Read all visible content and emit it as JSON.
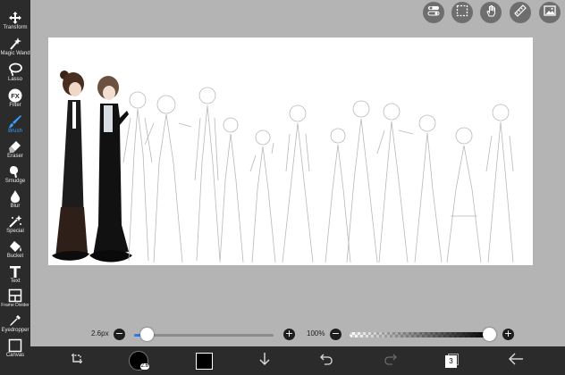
{
  "toolbar": {
    "items": [
      {
        "label": "Transform",
        "icon": "move-arrows-icon"
      },
      {
        "label": "Magic Wand",
        "icon": "magic-wand-icon"
      },
      {
        "label": "Lasso",
        "icon": "lasso-icon"
      },
      {
        "label": "Filter",
        "icon": "fx-icon"
      },
      {
        "label": "Brush",
        "icon": "brush-icon"
      },
      {
        "label": "Eraser",
        "icon": "eraser-icon"
      },
      {
        "label": "Smudge",
        "icon": "smudge-icon"
      },
      {
        "label": "Blur",
        "icon": "drop-icon"
      },
      {
        "label": "Special",
        "icon": "sparkle-icon"
      },
      {
        "label": "Bucket",
        "icon": "bucket-icon"
      },
      {
        "label": "Text",
        "icon": "text-icon"
      },
      {
        "label": "Frame Divider",
        "icon": "frame-divider-icon"
      },
      {
        "label": "Eyedropper",
        "icon": "eyedropper-icon"
      },
      {
        "label": "Canvas",
        "icon": "canvas-icon"
      }
    ],
    "active": "Brush"
  },
  "top_buttons": [
    "toggle-icon",
    "selection-icon",
    "hand-icon",
    "ruler-icon",
    "image-icon"
  ],
  "brush_size": {
    "label": "2.6px",
    "value": 0.09
  },
  "opacity": {
    "label": "100%",
    "value": 1.0
  },
  "bottom_bar": {
    "brush_badge": "2.6",
    "layer_count": "3",
    "current_color": "#000000",
    "accent_color": "#2d7ce0"
  },
  "colors": {
    "toolbar_bg": "#2b2b2b",
    "workspace_bg": "#b4b4b4",
    "canvas_bg": "#ffffff"
  }
}
